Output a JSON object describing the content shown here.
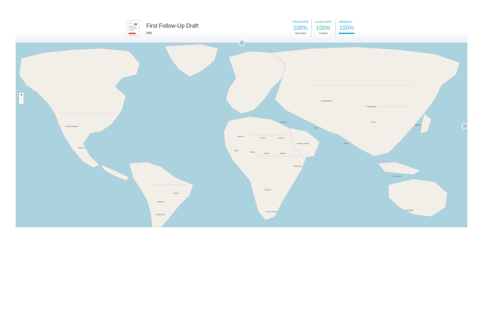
{
  "header": {
    "title": "First Follow-Up Draft",
    "subtitle": "info"
  },
  "metrics": [
    {
      "label": "OPEN RATE",
      "value": "100%",
      "sub": "Received",
      "color": "#3ab0e2"
    },
    {
      "label": "CLICK RATE",
      "value": "100%",
      "sub": "Clicked",
      "color": "#35b98a"
    },
    {
      "label": "SENDING...",
      "value": "100%",
      "sub": "",
      "color": "#3ab0e2"
    }
  ],
  "map": {
    "zoom_in": "+",
    "zoom_out": "−",
    "labels": [
      {
        "text": "United States",
        "name": "label-united-states"
      },
      {
        "text": "Mexico",
        "name": "label-mexico"
      },
      {
        "text": "Brazil",
        "name": "label-brazil"
      },
      {
        "text": "Bolivia",
        "name": "label-bolivia"
      },
      {
        "text": "Argentina",
        "name": "label-argentina"
      },
      {
        "text": "Algeria",
        "name": "label-algeria"
      },
      {
        "text": "Libya",
        "name": "label-libya"
      },
      {
        "text": "Egypt",
        "name": "label-egypt"
      },
      {
        "text": "Mali",
        "name": "label-mali"
      },
      {
        "text": "Niger",
        "name": "label-niger"
      },
      {
        "text": "Chad",
        "name": "label-chad"
      },
      {
        "text": "Sudan",
        "name": "label-sudan"
      },
      {
        "text": "Ethiopia",
        "name": "label-ethiopia"
      },
      {
        "text": "Angola",
        "name": "label-angola"
      },
      {
        "text": "South Africa",
        "name": "label-south-africa"
      },
      {
        "text": "Saudi Arabia",
        "name": "label-saudi-arabia"
      },
      {
        "text": "Iran",
        "name": "label-iran"
      },
      {
        "text": "India",
        "name": "label-india"
      },
      {
        "text": "Mongolia",
        "name": "label-mongolia"
      },
      {
        "text": "China",
        "name": "label-china"
      },
      {
        "text": "Japan",
        "name": "label-japan"
      },
      {
        "text": "Indonesia",
        "name": "label-indonesia"
      },
      {
        "text": "Australia",
        "name": "label-australia"
      },
      {
        "text": "Kazakhstan",
        "name": "label-kazakhstan"
      },
      {
        "text": "Türkiye",
        "name": "label-turkiye"
      }
    ]
  }
}
